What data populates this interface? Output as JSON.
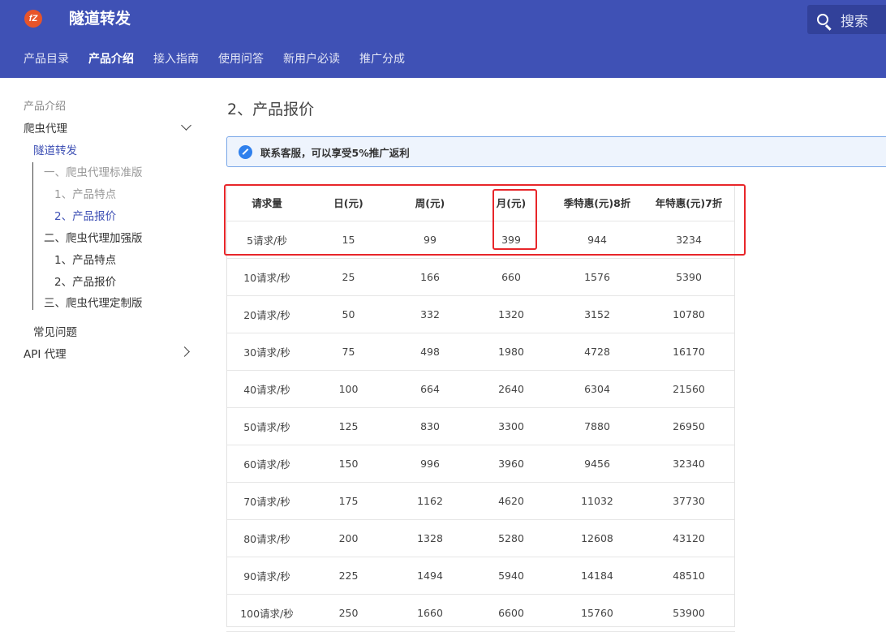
{
  "header": {
    "logo_text": "fZ",
    "site_title": "隧道转发",
    "search_label": "搜索",
    "tabs": [
      "产品目录",
      "产品介绍",
      "接入指南",
      "使用问答",
      "新用户必读",
      "推广分成"
    ]
  },
  "sidebar": {
    "caption": "产品介绍",
    "group1": "爬虫代理",
    "current": "隧道转发",
    "sub1": "一、爬虫代理标准版",
    "sub1_a": "1、产品特点",
    "sub1_b": "2、产品报价",
    "sub2": "二、爬虫代理加强版",
    "sub2_a": "1、产品特点",
    "sub2_b": "2、产品报价",
    "sub3": "三、爬虫代理定制版",
    "faq": "常见问题",
    "api": "API 代理"
  },
  "main": {
    "title": "2、产品报价",
    "notice": "联系客服，可以享受5%推广返利"
  },
  "table": {
    "headers": [
      "请求量",
      "日(元)",
      "周(元)",
      "月(元)",
      "季特惠(元)8折",
      "年特惠(元)7折"
    ],
    "rows": [
      [
        "5请求/秒",
        "15",
        "99",
        "399",
        "944",
        "3234"
      ],
      [
        "10请求/秒",
        "25",
        "166",
        "660",
        "1576",
        "5390"
      ],
      [
        "20请求/秒",
        "50",
        "332",
        "1320",
        "3152",
        "10780"
      ],
      [
        "30请求/秒",
        "75",
        "498",
        "1980",
        "4728",
        "16170"
      ],
      [
        "40请求/秒",
        "100",
        "664",
        "2640",
        "6304",
        "21560"
      ],
      [
        "50请求/秒",
        "125",
        "830",
        "3300",
        "7880",
        "26950"
      ],
      [
        "60请求/秒",
        "150",
        "996",
        "3960",
        "9456",
        "32340"
      ],
      [
        "70请求/秒",
        "175",
        "1162",
        "4620",
        "11032",
        "37730"
      ],
      [
        "80请求/秒",
        "200",
        "1328",
        "5280",
        "12608",
        "43120"
      ],
      [
        "90请求/秒",
        "225",
        "1494",
        "5940",
        "14184",
        "48510"
      ],
      [
        "100请求/秒",
        "250",
        "1660",
        "6600",
        "15760",
        "53900"
      ]
    ]
  },
  "colors": {
    "header_bg": "#3f51b5",
    "accent": "#3f51b5",
    "highlight": "#e8262a",
    "notice_border": "#7aa7e8"
  }
}
